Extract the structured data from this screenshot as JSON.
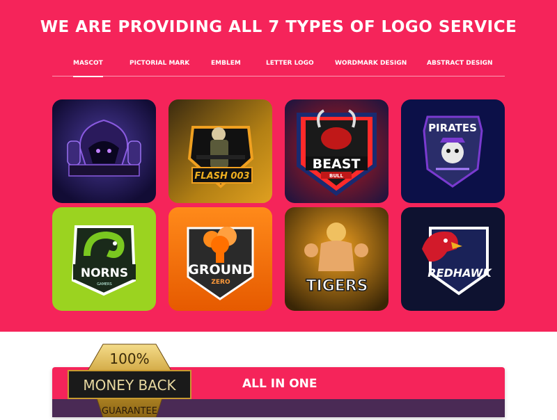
{
  "hero": {
    "title": "WE ARE PROVIDING ALL 7 TYPES OF LOGO SERVICE",
    "bg": "#f5245a"
  },
  "tabs": [
    {
      "label": "MASCOT",
      "active": true
    },
    {
      "label": "PICTORIAL MARK"
    },
    {
      "label": "EMBLEM"
    },
    {
      "label": "LETTER LOGO"
    },
    {
      "label": "WORDMARK DESIGN"
    },
    {
      "label": "ABSTRACT DESIGN"
    }
  ],
  "logos": [
    {
      "name": "hooded-figure",
      "text": ""
    },
    {
      "name": "flash-soldier",
      "text": "FLASH 003"
    },
    {
      "name": "beast-bull",
      "text": "BEAST",
      "sub": "BULL"
    },
    {
      "name": "pirates",
      "text": "PIRATES"
    },
    {
      "name": "norns-snake",
      "text": "NORNS",
      "sub": "GAMERS"
    },
    {
      "name": "ground-zero",
      "text": "GROUND",
      "sub": "ZERO"
    },
    {
      "name": "tigers",
      "text": "TIGERS"
    },
    {
      "name": "redhawk",
      "text": "REDHAWK"
    }
  ],
  "badge": {
    "percent": "100%",
    "line1": "MONEY BACK",
    "line2": "GUARANTEE"
  },
  "bottom": {
    "heading": "ALL IN ONE"
  }
}
